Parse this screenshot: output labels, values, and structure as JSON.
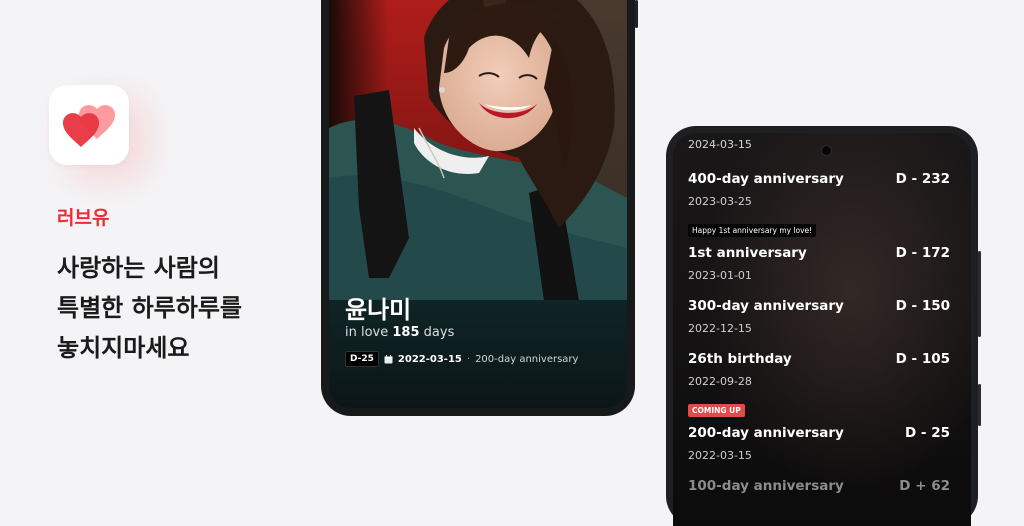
{
  "promo": {
    "brand": "러브유",
    "headline": [
      "사랑하는 사람의",
      "특별한 하루하루를",
      "놓치지마세요"
    ]
  },
  "app_icon": {
    "name": "heart-icon",
    "color_front": "#e8343f",
    "color_back": "#ff8a8e"
  },
  "couple_screen": {
    "name": "윤나미",
    "love_prefix": "in love",
    "love_days": "185",
    "love_suffix": "days",
    "dday_badge": "D-25",
    "event_date": "2022-03-15",
    "separator": "·",
    "event_label": "200-day anniversary"
  },
  "anniversary_screen": {
    "top_date": "2024-03-15",
    "items": [
      {
        "title": "400-day anniversary",
        "date": "2023-03-25",
        "dday": "D - 232"
      },
      {
        "memo": "Happy 1st anniversary my love!",
        "title": "1st anniversary",
        "date": "2023-01-01",
        "dday": "D - 172"
      },
      {
        "title": "300-day anniversary",
        "date": "2022-12-15",
        "dday": "D - 150"
      },
      {
        "title": "26th birthday",
        "date": "2022-09-28",
        "dday": "D - 105"
      },
      {
        "badge": "COMING UP",
        "title": "200-day anniversary",
        "date": "2022-03-15",
        "dday": "D - 25"
      },
      {
        "title": "100-day anniversary",
        "dday": "D + 62"
      }
    ]
  },
  "colors": {
    "brand_red": "#ee2b34",
    "coming_up": "#e04b4b"
  }
}
